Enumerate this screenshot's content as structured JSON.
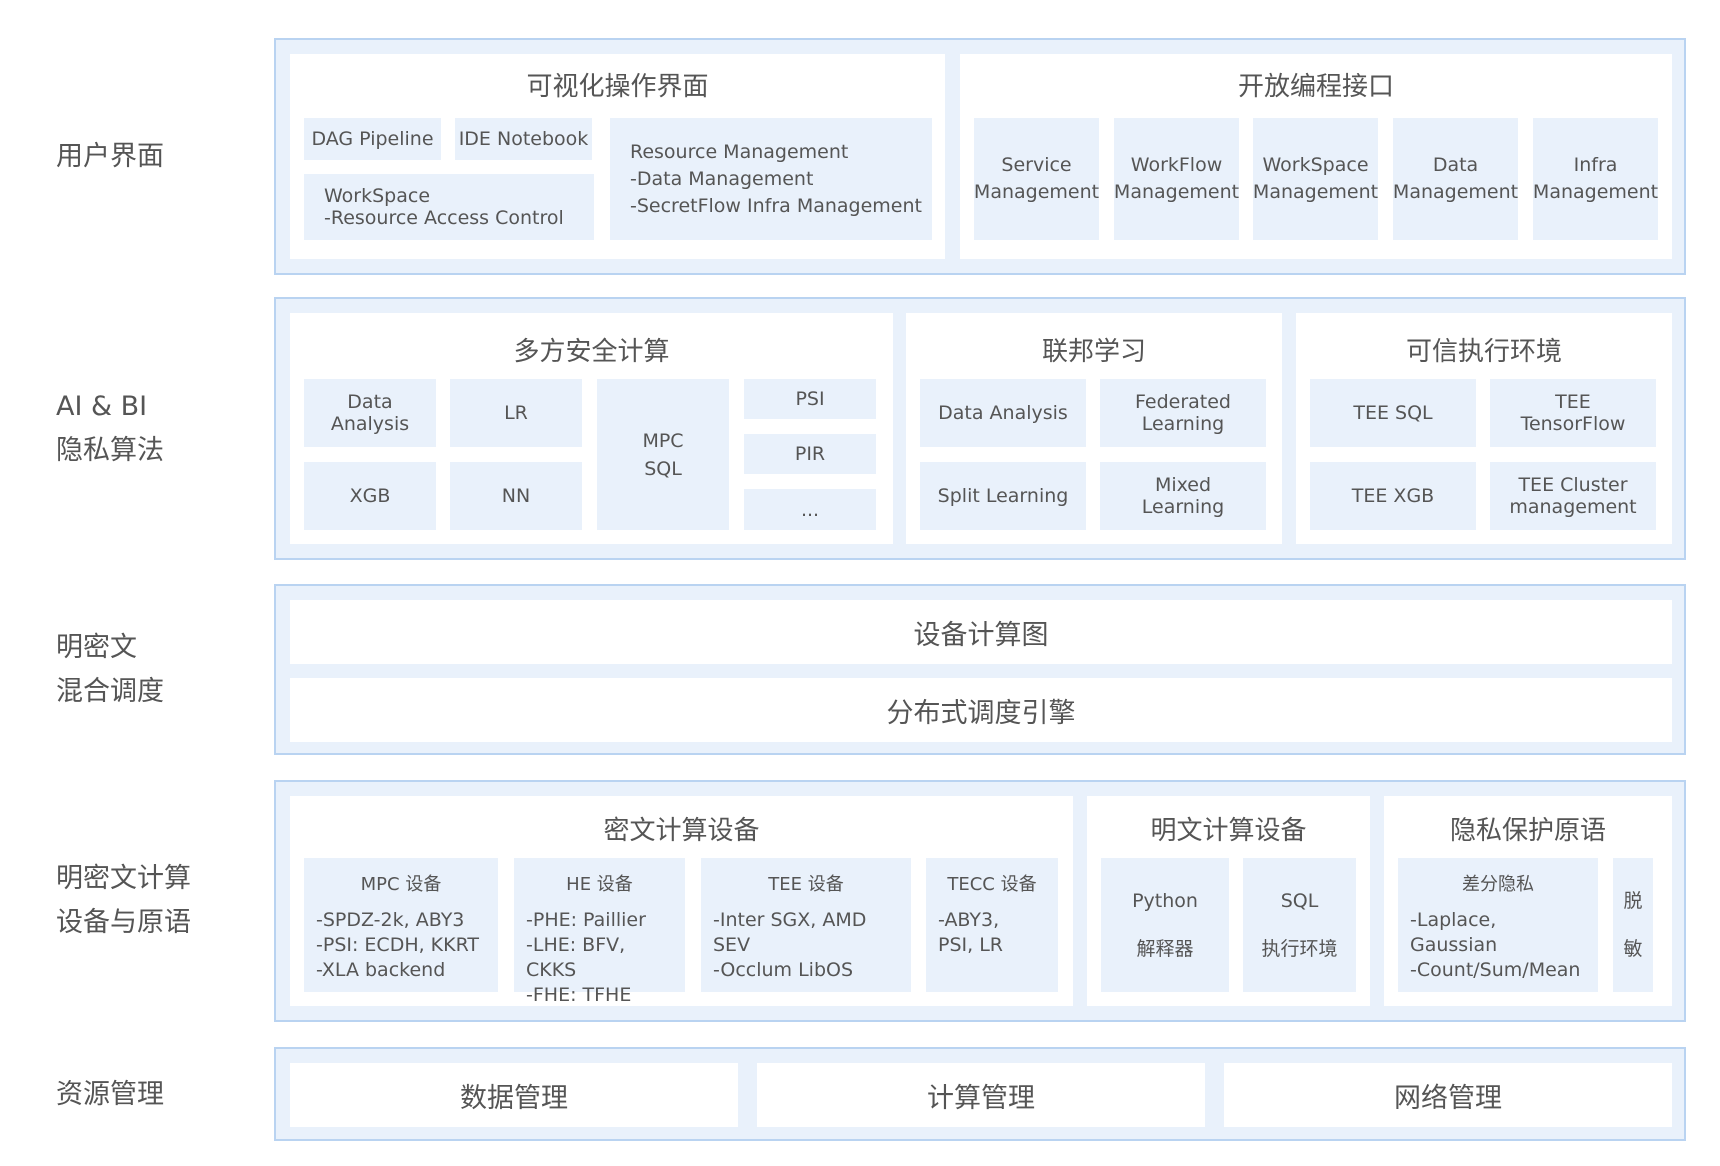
{
  "labels": {
    "user": "用户界面",
    "ai": "AI & BI\n隐私算法",
    "mix": "明密文\n混合调度",
    "devices": "明密文计算\n设备与原语",
    "resource": "资源管理"
  },
  "ui": {
    "visual": {
      "title": "可视化操作界面",
      "dag": "DAG Pipeline",
      "ide": "IDE Notebook",
      "workspace": "WorkSpace\n-Resource Access Control",
      "resource": "Resource Management\n-Data Management\n-SecretFlow Infra Management"
    },
    "api": {
      "title": "开放编程接口",
      "items": [
        "Service\nManagement",
        "WorkFlow\nManagement",
        "WorkSpace\nManagement",
        "Data\nManagement",
        "Infra\nManagement"
      ]
    }
  },
  "algo": {
    "mpc": {
      "title": "多方安全计算",
      "data_analysis": "Data\nAnalysis",
      "lr": "LR",
      "xgb": "XGB",
      "nn": "NN",
      "mpc_sql": "MPC\nSQL",
      "psi": "PSI",
      "pir": "PIR",
      "more": "..."
    },
    "fl": {
      "title": "联邦学习",
      "data_analysis": "Data Analysis",
      "federated": "Federated\nLearning",
      "split": "Split Learning",
      "mixed": "Mixed\nLearning"
    },
    "tee": {
      "title": "可信执行环境",
      "sql": "TEE SQL",
      "tf": "TEE\nTensorFlow",
      "xgb": "TEE XGB",
      "cluster": "TEE Cluster\nmanagement"
    }
  },
  "schedule": {
    "graph": "设备计算图",
    "engine": "分布式调度引擎"
  },
  "devices": {
    "cipher": {
      "title": "密文计算设备",
      "mpc": {
        "title": "MPC 设备",
        "lines": "-SPDZ-2k, ABY3\n-PSI: ECDH, KKRT\n-XLA backend"
      },
      "he": {
        "title": "HE 设备",
        "lines": "-PHE: Paillier\n-LHE: BFV, CKKS\n-FHE: TFHE"
      },
      "tee": {
        "title": "TEE 设备",
        "lines": "-Inter SGX, AMD SEV\n-Occlum LibOS"
      },
      "tecc": {
        "title": "TECC 设备",
        "lines": "-ABY3,\nPSI, LR"
      }
    },
    "plain": {
      "title": "明文计算设备",
      "python": "Python\n\n解释器",
      "sql": "SQL\n\n执行环境"
    },
    "privacy": {
      "title": "隐私保护原语",
      "dp": {
        "title": "差分隐私",
        "lines": "-Laplace, Gaussian\n-Count/Sum/Mean"
      },
      "desens": "脱\n\n敏"
    }
  },
  "resource": {
    "data": "数据管理",
    "compute": "计算管理",
    "network": "网络管理"
  }
}
